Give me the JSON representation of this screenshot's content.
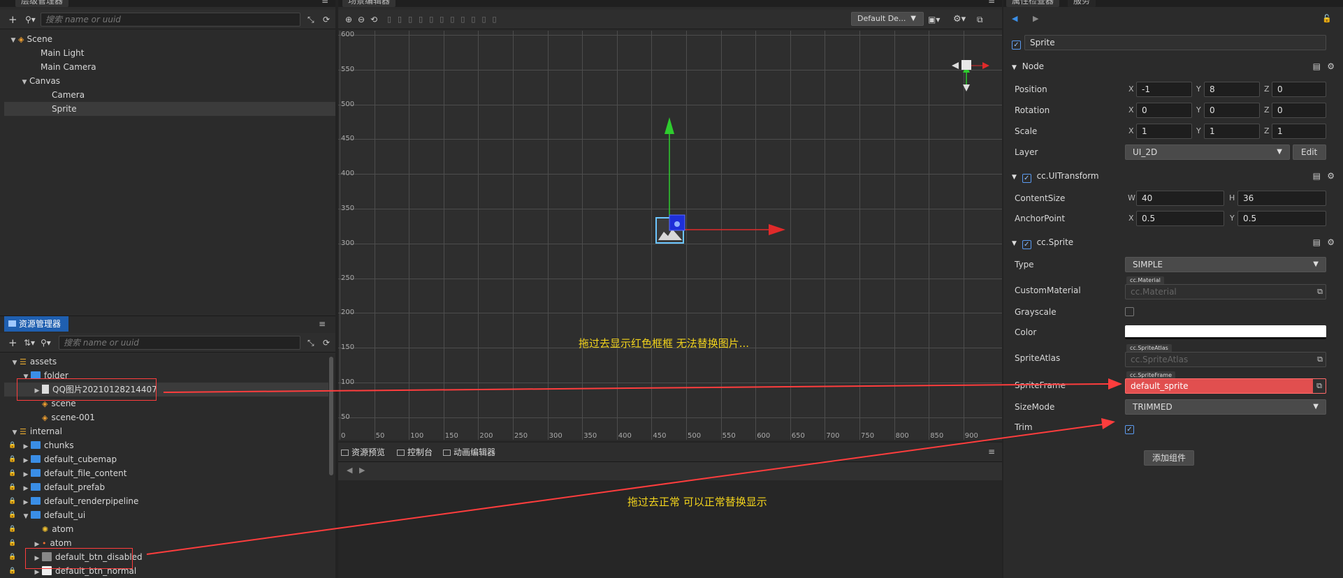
{
  "hierarchy": {
    "tab": "层级管理器",
    "search_placeholder": "搜索 name or uuid",
    "items": [
      {
        "label": "Scene",
        "indent": 0,
        "arrow": "▼",
        "icon": "scene"
      },
      {
        "label": "Main Light",
        "indent": 2
      },
      {
        "label": "Main Camera",
        "indent": 2
      },
      {
        "label": "Canvas",
        "indent": 1,
        "arrow": "▼"
      },
      {
        "label": "Camera",
        "indent": 3
      },
      {
        "label": "Sprite",
        "indent": 3,
        "selected": true
      }
    ]
  },
  "assets": {
    "tab": "资源管理器",
    "search_placeholder": "搜索 name or uuid",
    "items": [
      {
        "label": "assets",
        "indent": 0,
        "arrow": "▼",
        "icon": "db"
      },
      {
        "label": "folder",
        "indent": 1,
        "arrow": "▼",
        "icon": "folder"
      },
      {
        "label": "QQ图片20210128214407",
        "indent": 2,
        "arrow": "▶",
        "icon": "file",
        "boxed": true
      },
      {
        "label": "scene",
        "indent": 2,
        "icon": "scene"
      },
      {
        "label": "scene-001",
        "indent": 2,
        "icon": "scene"
      },
      {
        "label": "internal",
        "indent": 0,
        "arrow": "▼",
        "icon": "db"
      },
      {
        "label": "chunks",
        "indent": 1,
        "arrow": "▶",
        "icon": "folder",
        "lock": true
      },
      {
        "label": "default_cubemap",
        "indent": 1,
        "arrow": "▶",
        "icon": "folder",
        "lock": true
      },
      {
        "label": "default_file_content",
        "indent": 1,
        "arrow": "▶",
        "icon": "folder",
        "lock": true
      },
      {
        "label": "default_prefab",
        "indent": 1,
        "arrow": "▶",
        "icon": "folder",
        "lock": true
      },
      {
        "label": "default_renderpipeline",
        "indent": 1,
        "arrow": "▶",
        "icon": "folder",
        "lock": true
      },
      {
        "label": "default_ui",
        "indent": 1,
        "arrow": "▼",
        "icon": "folder",
        "lock": true
      },
      {
        "label": "atom",
        "indent": 2,
        "icon": "atom",
        "lock": true
      },
      {
        "label": "atom",
        "indent": 2,
        "arrow": "▶",
        "icon": "atom2",
        "lock": true
      },
      {
        "label": "default_btn_disabled",
        "indent": 2,
        "arrow": "▶",
        "icon": "img",
        "lock": true,
        "boxed": true
      },
      {
        "label": "default_btn_normal",
        "indent": 2,
        "arrow": "▶",
        "icon": "imgw",
        "lock": true
      }
    ]
  },
  "scene": {
    "tab": "场景编辑器",
    "camera_select": "Default De...",
    "y_ticks": [
      "600",
      "550",
      "500",
      "450",
      "400",
      "350",
      "300",
      "250",
      "200",
      "150",
      "100",
      "50"
    ],
    "x_ticks": [
      "0",
      "50",
      "100",
      "150",
      "200",
      "250",
      "300",
      "350",
      "400",
      "450",
      "500",
      "550",
      "600",
      "650",
      "700",
      "750",
      "800",
      "850",
      "900"
    ],
    "note1": "拖过去显示红色框框 无法替换图片...",
    "note2": "拖过去正常 可以正常替换显示"
  },
  "bottom": {
    "tabs": [
      "资源预览",
      "控制台",
      "动画编辑器"
    ]
  },
  "inspector": {
    "tabs": [
      "属性检查器",
      "服务"
    ],
    "node_name": "Sprite",
    "node_section": "Node",
    "position": {
      "label": "Position",
      "x": "-1",
      "y": "8",
      "z": "0"
    },
    "rotation": {
      "label": "Rotation",
      "x": "0",
      "y": "0",
      "z": "0"
    },
    "scale": {
      "label": "Scale",
      "x": "1",
      "y": "1",
      "z": "1"
    },
    "layer": {
      "label": "Layer",
      "value": "UI_2D",
      "edit": "Edit"
    },
    "uitransform": {
      "section": "cc.UITransform",
      "content_label": "ContentSize",
      "w": "40",
      "h": "36",
      "anchor_label": "AnchorPoint",
      "ax": "0.5",
      "ay": "0.5"
    },
    "sprite": {
      "section": "cc.Sprite",
      "type_label": "Type",
      "type_value": "SIMPLE",
      "material_label": "CustomMaterial",
      "material_tag": "cc.Material",
      "material_value": "cc.Material",
      "grayscale_label": "Grayscale",
      "color_label": "Color",
      "atlas_label": "SpriteAtlas",
      "atlas_tag": "cc.SpriteAtlas",
      "atlas_value": "cc.SpriteAtlas",
      "frame_label": "SpriteFrame",
      "frame_tag": "cc.SpriteFrame",
      "frame_value": "default_sprite",
      "sizemode_label": "SizeMode",
      "sizemode_value": "TRIMMED",
      "trim_label": "Trim"
    },
    "add_component": "添加组件"
  },
  "colors": {
    "accent": "#3a8ee6",
    "error": "#e14f4f",
    "annotation": "#ff3d3d",
    "note": "#f2d31c"
  }
}
